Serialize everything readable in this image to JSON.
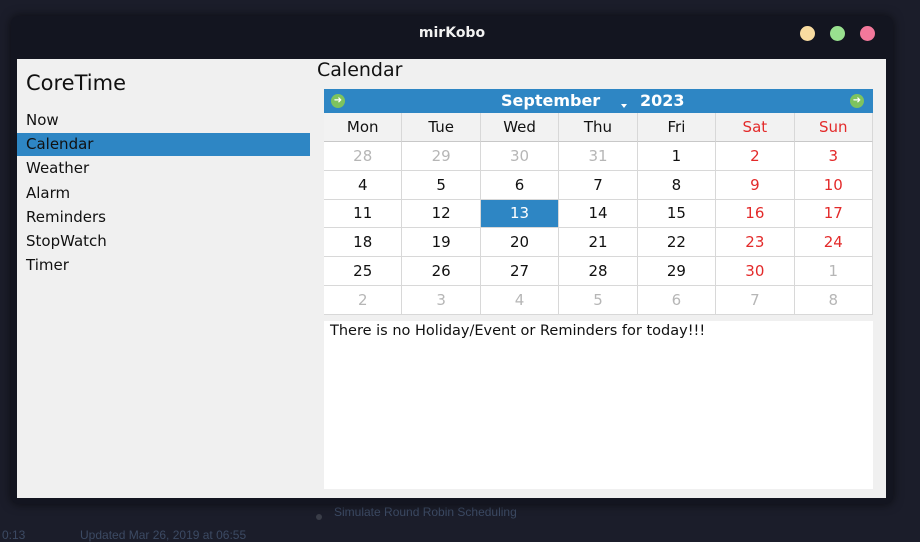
{
  "background": {
    "line1": "Simulate Round Robin Scheduling",
    "line2": "0:13",
    "line3": "Updated Mar 26, 2019 at 06:55"
  },
  "window": {
    "title": "mirKobo"
  },
  "colors": {
    "accent": "#2e86c4",
    "weekend": "#e32a2a",
    "muted": "#b6b6b6",
    "traffic_min": "#f8dba0",
    "traffic_max": "#99e08f",
    "traffic_close": "#f2789b",
    "nav_arrow": "#7ec35e"
  },
  "sidebar": {
    "app_name": "CoreTime",
    "items": [
      {
        "label": "Now"
      },
      {
        "label": "Calendar",
        "active": true
      },
      {
        "label": "Weather"
      },
      {
        "label": "Alarm"
      },
      {
        "label": "Reminders"
      },
      {
        "label": "StopWatch"
      },
      {
        "label": "Timer"
      }
    ]
  },
  "main": {
    "title": "Calendar",
    "calendar": {
      "month": "September",
      "year": "2023",
      "prev_icon": "arrow-left-icon",
      "next_icon": "arrow-right-icon",
      "weekdays": [
        "Mon",
        "Tue",
        "Wed",
        "Thu",
        "Fri",
        "Sat",
        "Sun"
      ],
      "weekend_indices": [
        5,
        6
      ],
      "selected_day": "13",
      "weeks": [
        [
          "28",
          "29",
          "30",
          "31",
          "1",
          "2",
          "3"
        ],
        [
          "4",
          "5",
          "6",
          "7",
          "8",
          "9",
          "10"
        ],
        [
          "11",
          "12",
          "13",
          "14",
          "15",
          "16",
          "17"
        ],
        [
          "18",
          "19",
          "20",
          "21",
          "22",
          "23",
          "24"
        ],
        [
          "25",
          "26",
          "27",
          "28",
          "29",
          "30",
          "1"
        ],
        [
          "2",
          "3",
          "4",
          "5",
          "6",
          "7",
          "8"
        ]
      ],
      "other_month": [
        [
          true,
          true,
          true,
          true,
          false,
          false,
          false
        ],
        [
          false,
          false,
          false,
          false,
          false,
          false,
          false
        ],
        [
          false,
          false,
          false,
          false,
          false,
          false,
          false
        ],
        [
          false,
          false,
          false,
          false,
          false,
          false,
          false
        ],
        [
          false,
          false,
          false,
          false,
          false,
          false,
          true
        ],
        [
          true,
          true,
          true,
          true,
          true,
          true,
          true
        ]
      ]
    },
    "events_text": "There is no Holiday/Event or Reminders for today!!!"
  }
}
